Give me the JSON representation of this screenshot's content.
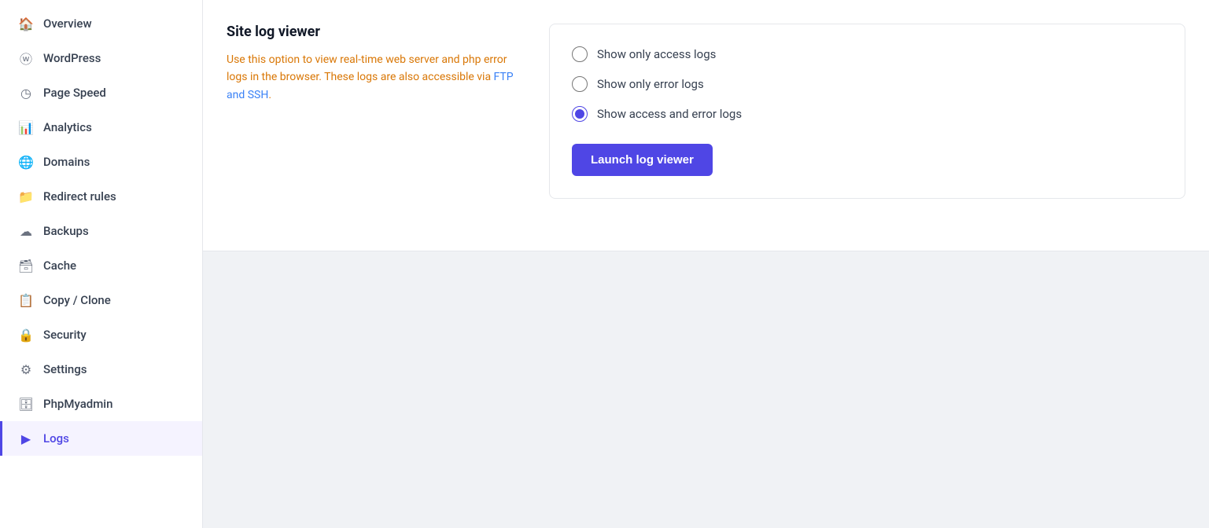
{
  "sidebar": {
    "items": [
      {
        "id": "overview",
        "label": "Overview",
        "icon": "🏠",
        "active": false
      },
      {
        "id": "wordpress",
        "label": "WordPress",
        "icon": "W",
        "active": false
      },
      {
        "id": "page-speed",
        "label": "Page Speed",
        "icon": "⏱",
        "active": false
      },
      {
        "id": "analytics",
        "label": "Analytics",
        "icon": "📊",
        "active": false
      },
      {
        "id": "domains",
        "label": "Domains",
        "icon": "🌐",
        "active": false
      },
      {
        "id": "redirect-rules",
        "label": "Redirect rules",
        "icon": "📂",
        "active": false
      },
      {
        "id": "backups",
        "label": "Backups",
        "icon": "☁",
        "active": false
      },
      {
        "id": "cache",
        "label": "Cache",
        "icon": "🗃",
        "active": false
      },
      {
        "id": "copy-clone",
        "label": "Copy / Clone",
        "icon": "📋",
        "active": false
      },
      {
        "id": "security",
        "label": "Security",
        "icon": "🔒",
        "active": false
      },
      {
        "id": "settings",
        "label": "Settings",
        "icon": "⚙",
        "active": false
      },
      {
        "id": "phpmyadmin",
        "label": "PhpMyadmin",
        "icon": "🗄",
        "active": false
      },
      {
        "id": "logs",
        "label": "Logs",
        "icon": ">_",
        "active": true
      }
    ]
  },
  "main": {
    "section_title": "Site log viewer",
    "description_line1": "Use this option to view real-time web",
    "description_line2": "server and php error logs in the browser.",
    "description_line3": "These logs are also accessible via FTP",
    "description_line4": "and SSH.",
    "radio_options": [
      {
        "id": "access-only",
        "label": "Show only access logs",
        "checked": false
      },
      {
        "id": "error-only",
        "label": "Show only error logs",
        "checked": false
      },
      {
        "id": "access-and-error",
        "label": "Show access and error logs",
        "checked": true
      }
    ],
    "launch_button_label": "Launch log viewer"
  }
}
